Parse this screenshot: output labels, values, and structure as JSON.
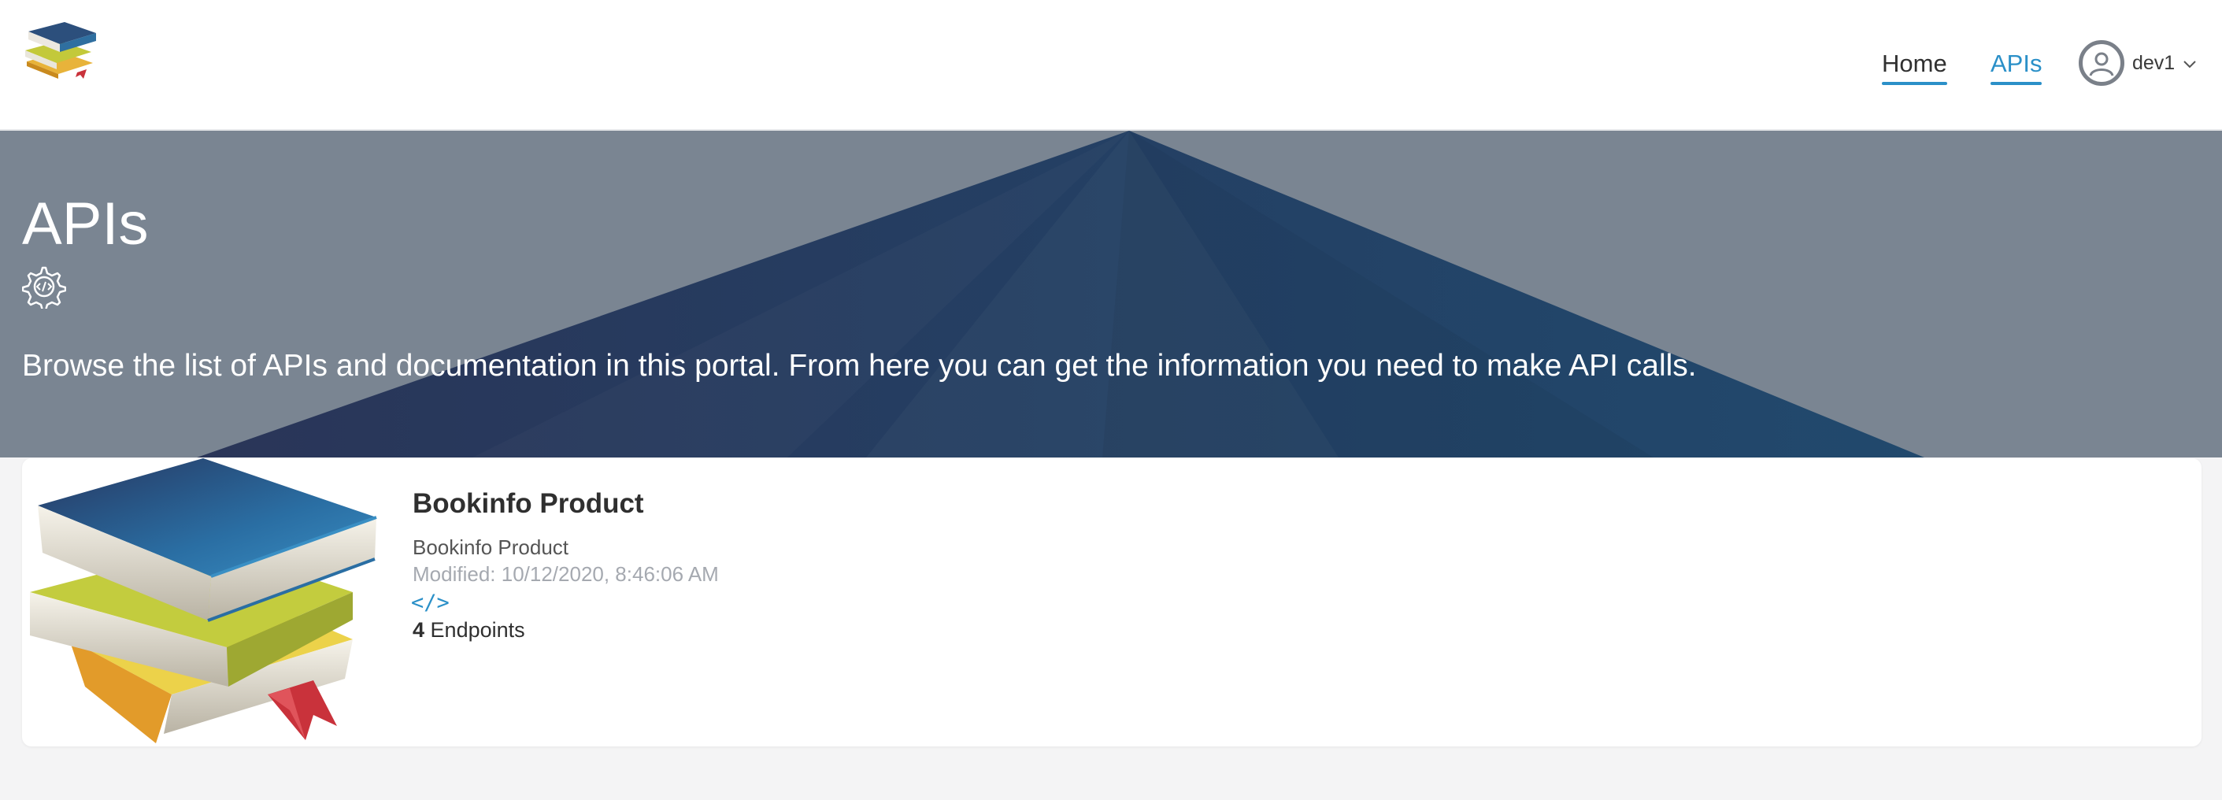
{
  "header": {
    "logo_icon": "books-logo-icon",
    "nav": {
      "home_label": "Home",
      "apis_label": "APIs"
    },
    "user": {
      "name": "dev1",
      "avatar_icon": "user-avatar-icon",
      "dropdown_icon": "chevron-down-icon"
    }
  },
  "hero": {
    "title": "APIs",
    "icon": "gear-code-icon",
    "description": "Browse the list of APIs and documentation in this portal. From here you can get the information you need to make API calls."
  },
  "apis": [
    {
      "title": "Bookinfo Product",
      "description": "Bookinfo Product",
      "modified_label": "Modified:",
      "modified": "10/12/2020, 8:46:06 AM",
      "code_icon": "</>",
      "endpoint_count": "4",
      "endpoints_label": "Endpoints",
      "image_icon": "books-stack-icon"
    }
  ],
  "colors": {
    "accent": "#2b90c8",
    "hero_bg": "#7a8592",
    "hero_triangle": "#23395e",
    "page_bg": "#f4f4f5",
    "card_bg": "#ffffff"
  }
}
